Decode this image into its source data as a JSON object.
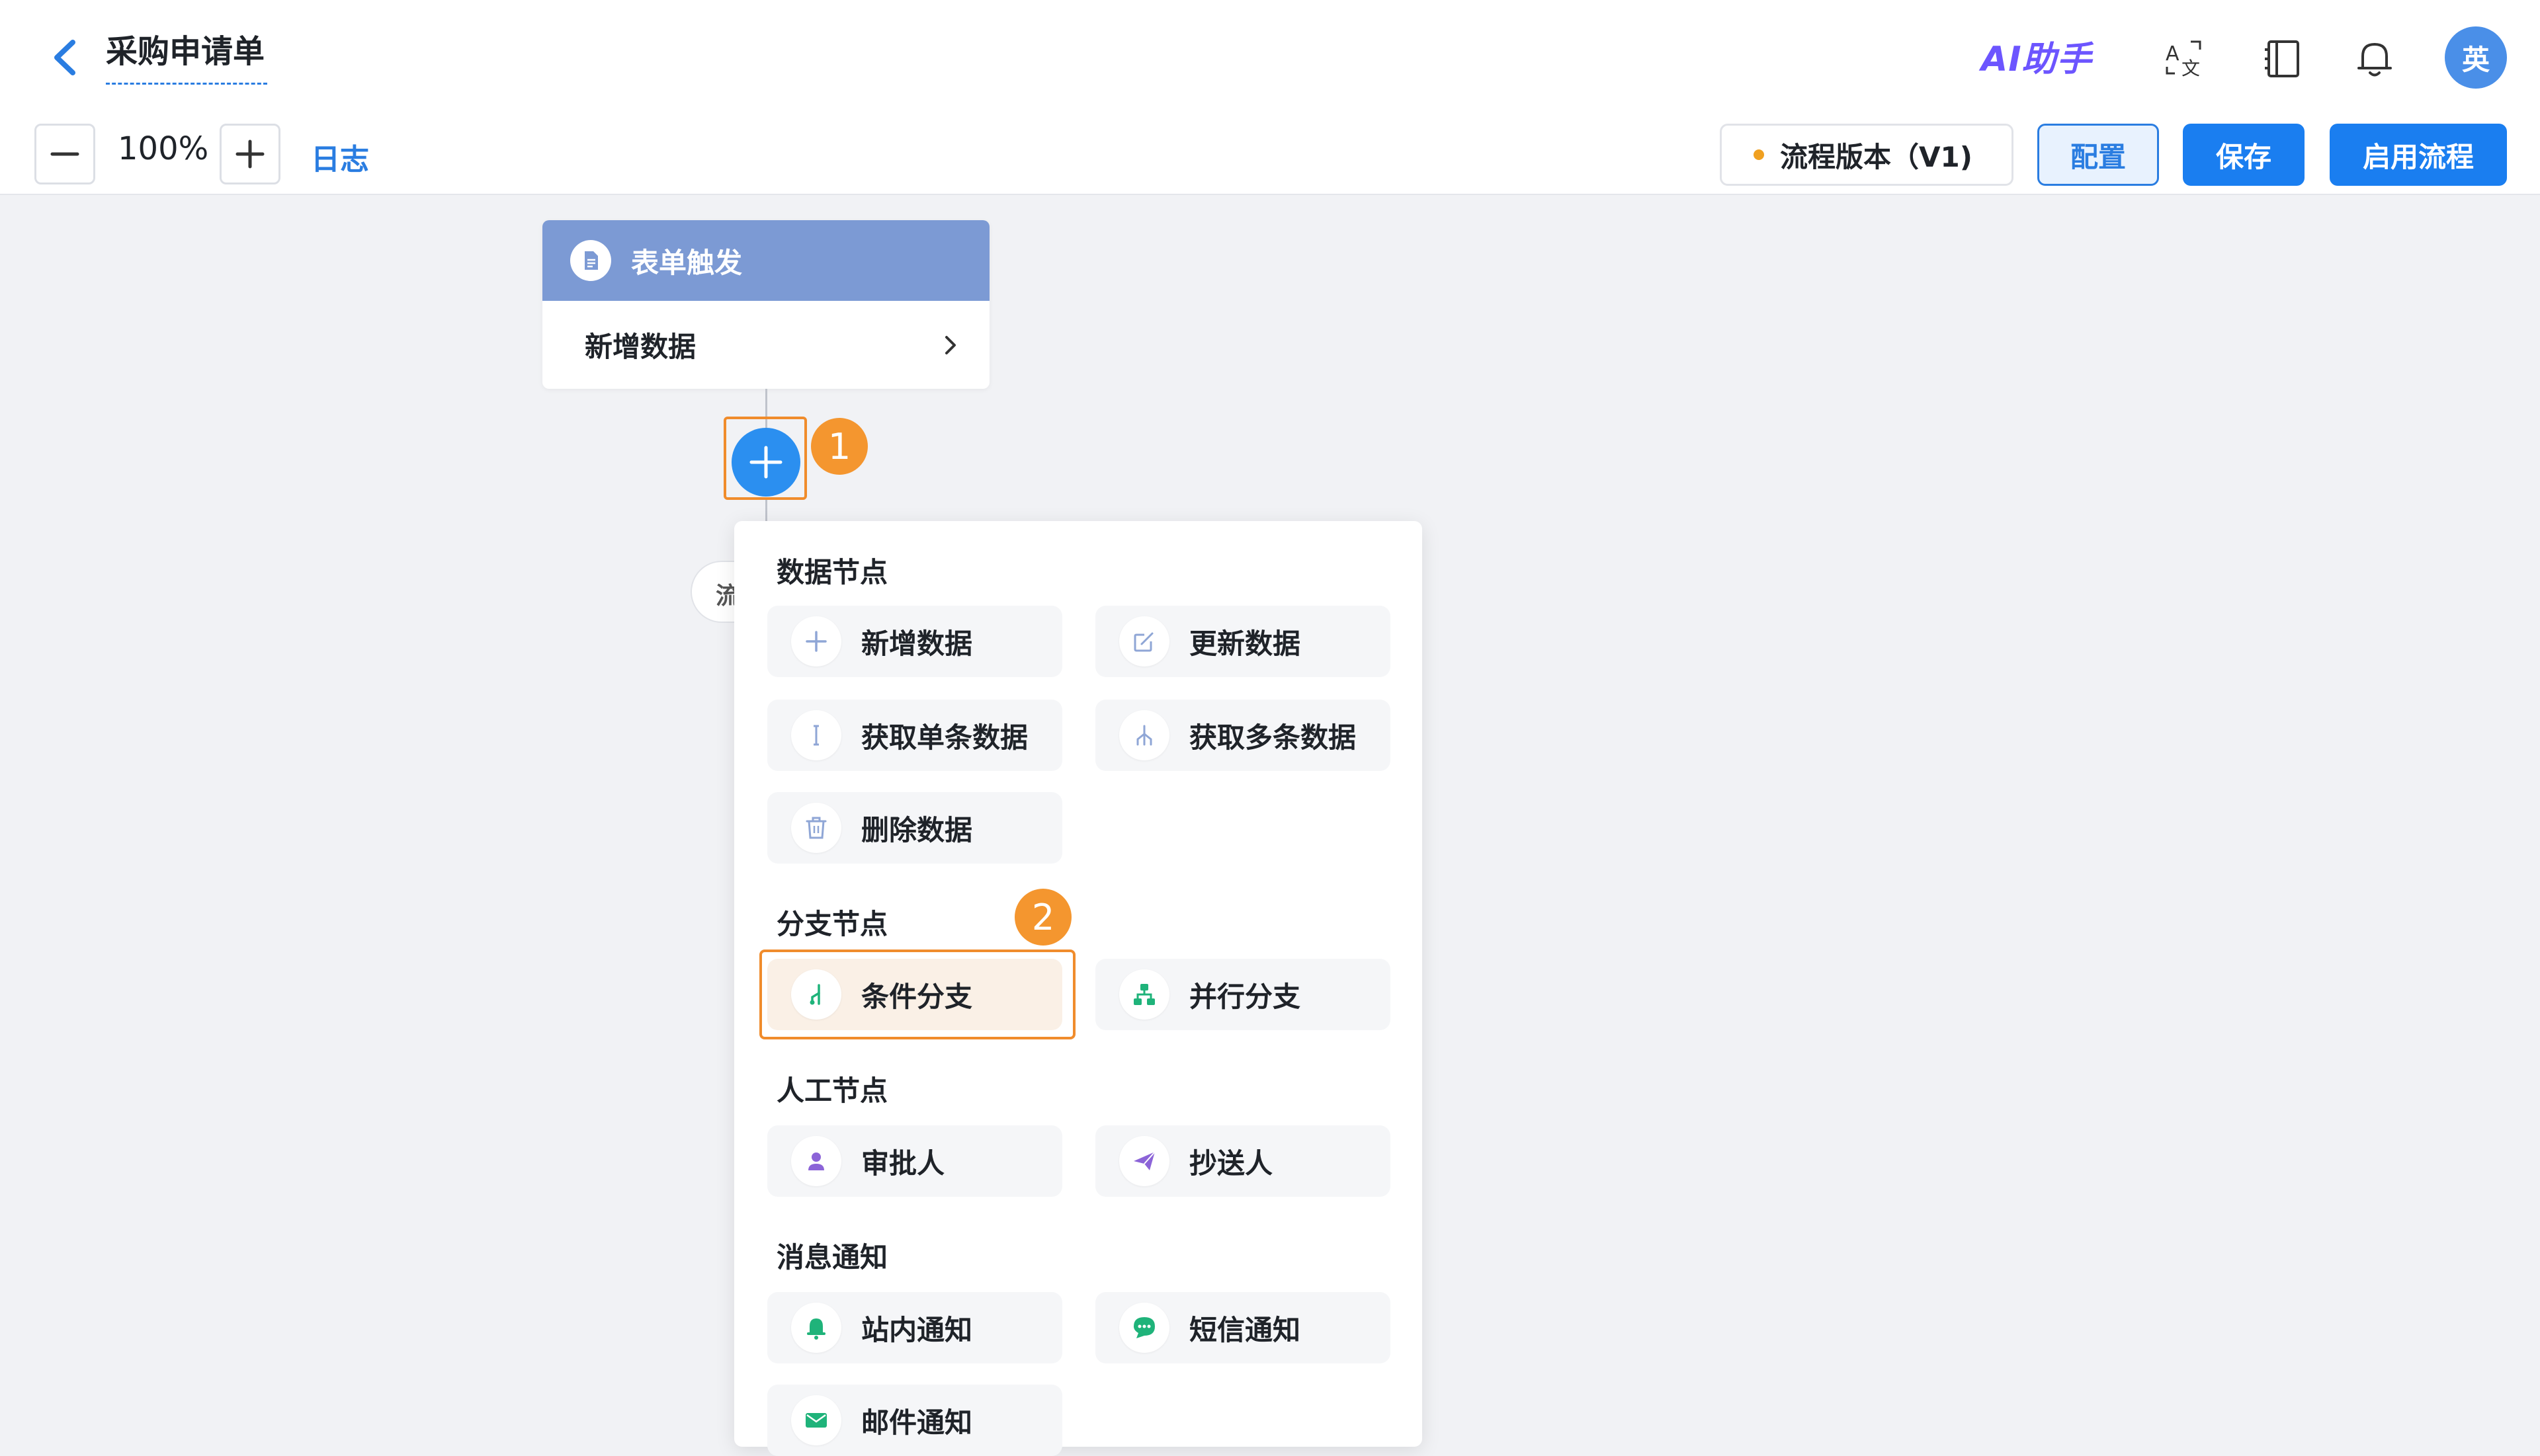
{
  "header": {
    "title": "采购申请单",
    "ai_assistant_label": "AI助手",
    "avatar_text": "英",
    "icons": [
      "translate-icon",
      "book-icon",
      "bell-icon"
    ]
  },
  "toolbar": {
    "zoom_level": "100%",
    "log_link": "日志",
    "version_label": "流程版本（V1)",
    "config_button": "配置",
    "save_button": "保存",
    "enable_button": "启用流程"
  },
  "canvas": {
    "trigger_node": {
      "title": "表单触发",
      "action": "新增数据"
    },
    "hidden_node_label": "流",
    "step_badges": [
      "1",
      "2"
    ]
  },
  "menu": {
    "sections": [
      {
        "title": "数据节点",
        "items": [
          {
            "label": "新增数据",
            "icon": "plus-icon"
          },
          {
            "label": "更新数据",
            "icon": "edit-icon"
          },
          {
            "label": "获取单条数据",
            "icon": "single-record-icon"
          },
          {
            "label": "获取多条数据",
            "icon": "multi-record-icon"
          },
          {
            "label": "删除数据",
            "icon": "trash-icon"
          }
        ]
      },
      {
        "title": "分支节点",
        "items": [
          {
            "label": "条件分支",
            "icon": "condition-branch-icon",
            "selected": true
          },
          {
            "label": "并行分支",
            "icon": "parallel-branch-icon"
          }
        ]
      },
      {
        "title": "人工节点",
        "items": [
          {
            "label": "审批人",
            "icon": "approver-icon"
          },
          {
            "label": "抄送人",
            "icon": "send-icon"
          }
        ]
      },
      {
        "title": "消息通知",
        "items": [
          {
            "label": "站内通知",
            "icon": "bell-icon"
          },
          {
            "label": "短信通知",
            "icon": "message-icon"
          },
          {
            "label": "邮件通知",
            "icon": "mail-icon"
          }
        ]
      }
    ]
  },
  "colors": {
    "primary": "#1a7ef0",
    "highlight": "#f08c2c",
    "trigger_header": "#7c9ad4",
    "ai_gradient": "#6c55ff"
  }
}
